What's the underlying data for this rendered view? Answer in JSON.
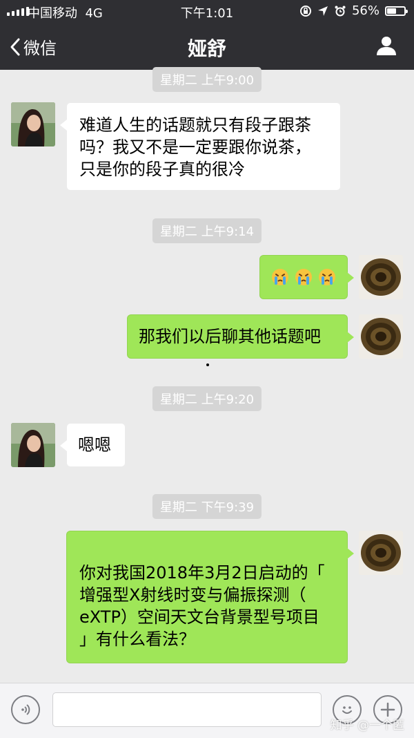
{
  "status_bar": {
    "carrier": "中国移动",
    "network": "4G",
    "time": "下午1:01",
    "battery_percent": "56%",
    "battery_level": 0.56
  },
  "header": {
    "back_label": "微信",
    "title": "娅舒"
  },
  "messages": [
    {
      "kind": "timestamp",
      "text": "星期二 上午9:00"
    },
    {
      "kind": "incoming",
      "lines": [
        "难道人生的话题就只有段子跟茶",
        "吗？我又不是一定要跟你说茶，",
        "只是你的段子真的很冷"
      ]
    },
    {
      "kind": "timestamp",
      "text": "星期二 上午9:14"
    },
    {
      "kind": "outgoing",
      "emoji": [
        "crying-face-emoji",
        "crying-face-emoji",
        "crying-face-emoji"
      ]
    },
    {
      "kind": "outgoing",
      "lines": [
        "那我们以后聊其他话题吧"
      ]
    },
    {
      "kind": "timestamp",
      "text": "星期二 上午9:20"
    },
    {
      "kind": "incoming",
      "lines": [
        "嗯嗯"
      ]
    },
    {
      "kind": "timestamp",
      "text": "星期二 下午9:39"
    },
    {
      "kind": "outgoing",
      "lines": [
        "你对我国2018年3月2日启动的「",
        "增强型X射线时变与偏振探测（",
        "eXTP）空间天文台背景型号项目",
        "」有什么看法？"
      ]
    }
  ],
  "input_bar": {
    "placeholder": ""
  },
  "watermark": "知乎 @一个匿",
  "colors": {
    "topbar": "#2f2f33",
    "background": "#ebebeb",
    "outgoing_bubble": "#9fe658",
    "incoming_bubble": "#ffffff",
    "timestamp_bg": "#d5d5d5"
  }
}
